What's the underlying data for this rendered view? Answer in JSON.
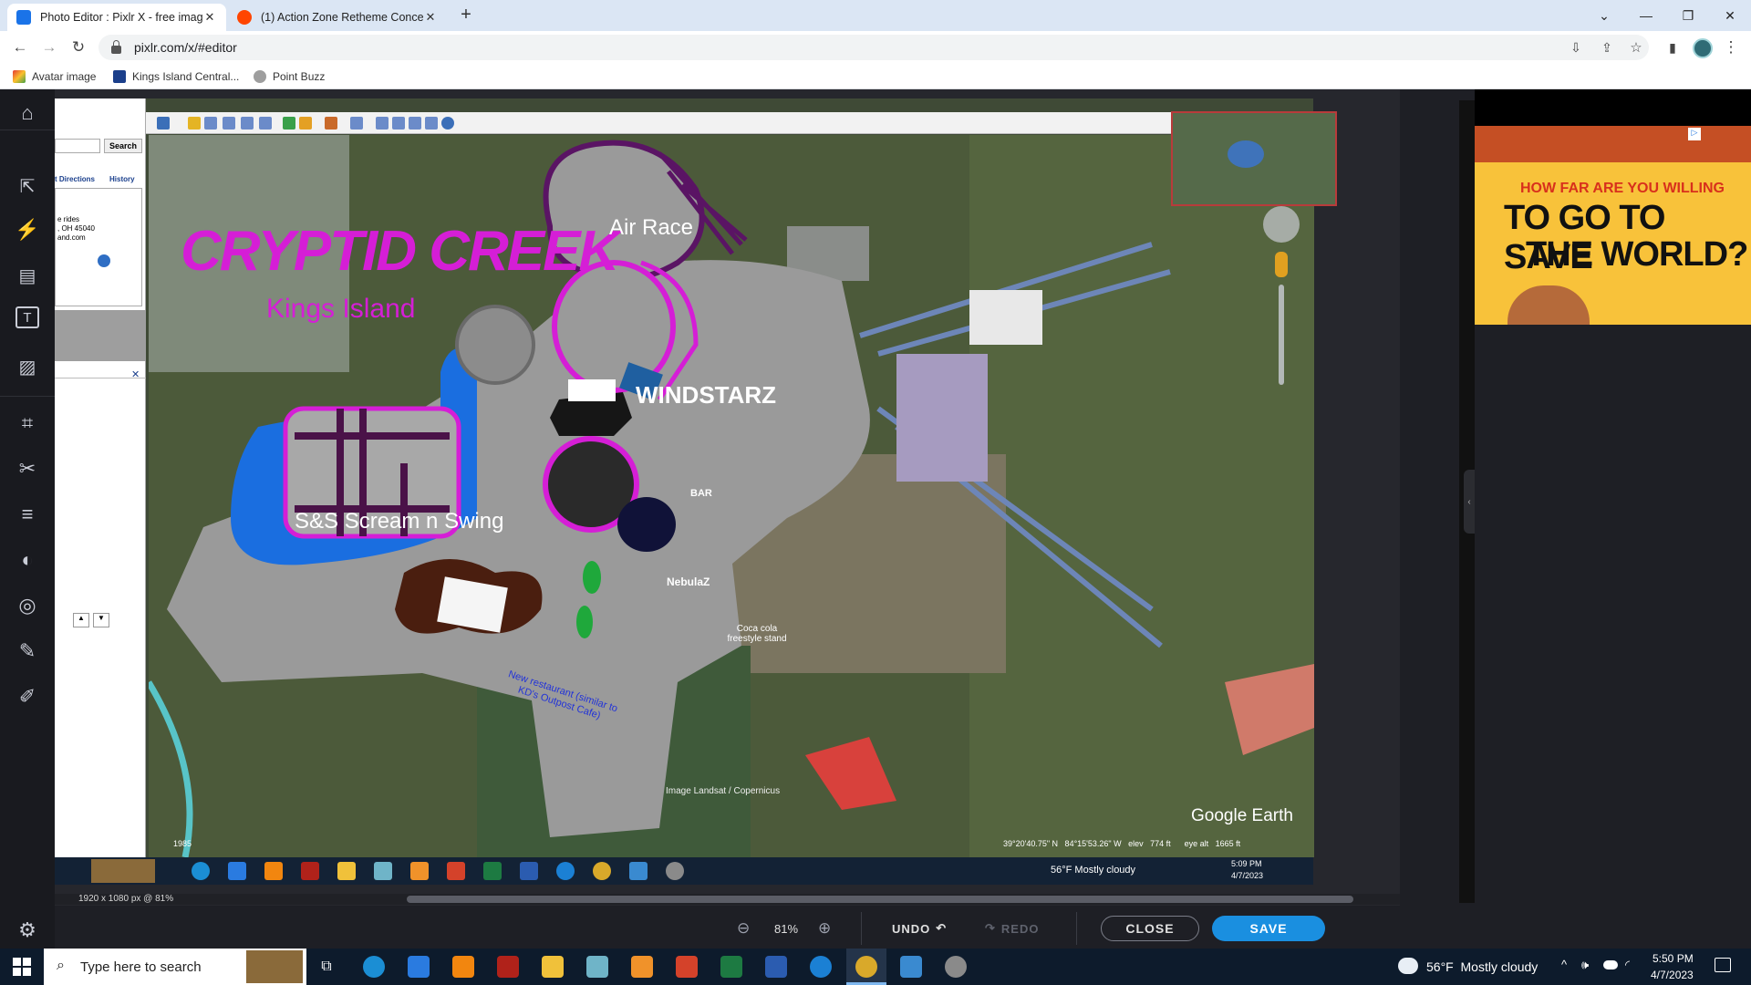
{
  "browser": {
    "tabs": [
      {
        "title": "Photo Editor : Pixlr X - free image",
        "active": true
      },
      {
        "title": "(1) Action Zone Retheme Concep",
        "active": false
      }
    ],
    "url": "pixlr.com/x/#editor",
    "bookmarks": [
      "Avatar image",
      "Kings Island Central...",
      "Point Buzz"
    ]
  },
  "editor": {
    "image_info": "1920 x 1080 px @ 81%",
    "zoom": "81%",
    "undo_label": "UNDO",
    "redo_label": "REDO",
    "close_label": "CLOSE",
    "save_label": "SAVE",
    "accent": "#1a8fe0"
  },
  "image": {
    "maps_panel": {
      "search_label": "Search",
      "tab_directions": "t Directions",
      "tab_history": "History",
      "address_lines": [
        "e rides",
        ", OH 45040",
        "and.com"
      ]
    },
    "map_labels": {
      "title": "CRYPTID CREEK",
      "subtitle": "Kings Island",
      "air_race": "Air Race",
      "windstarz": "WINDSTARZ",
      "bar": "BAR",
      "scream": "S&S Scream n Swing",
      "nebulaz": "NebulaZ",
      "coca_cola": "Coca cola freestyle stand",
      "restaurant": "New restaurant (similar to KD's Outpost Cafe)",
      "credit": "Image Landsat / Copernicus",
      "google_earth": "Google Earth",
      "year": "1985",
      "coords": "39°20'40.75\" N   84°15'53.26\" W   elev   774 ft      eye alt   1665 ft"
    },
    "inner_taskbar": {
      "weather": "56°F  Mostly cloudy",
      "time": "5:09 PM",
      "date": "4/7/2023"
    }
  },
  "ad": {
    "line1": "HOW FAR ARE YOU WILLING",
    "line2": "TO GO TO SAVE",
    "line3": "THE WORLD?"
  },
  "taskbar": {
    "search_placeholder": "Type here to search",
    "weather": "56°F  Mostly cloudy",
    "time": "5:50 PM",
    "date": "4/7/2023"
  }
}
